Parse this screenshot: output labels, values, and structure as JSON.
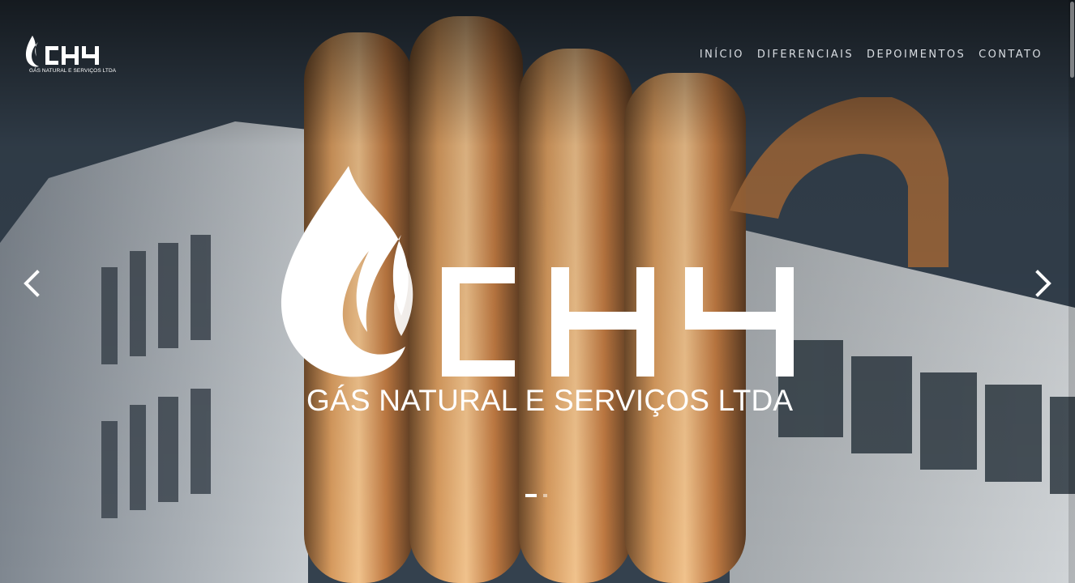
{
  "brand": {
    "mark_text": "CH4",
    "subtitle": "GÁS NATURAL E SERVIÇOS LTDA"
  },
  "nav": {
    "items": [
      "INÍCIO",
      "DIFERENCIAIS",
      "DEPOIMENTOS",
      "CONTATO"
    ]
  },
  "hero": {
    "logo_text": "CH4",
    "tagline": "GÁS NATURAL E SERVIÇOS LTDA",
    "slide_count": 2,
    "active_slide": 1
  },
  "icons": {
    "prev": "chevron-left-icon",
    "next": "chevron-right-icon",
    "flame": "flame-icon"
  },
  "colors": {
    "text": "#ffffff",
    "nav_text": "#d9dde2",
    "pipe": "#c9894d"
  }
}
